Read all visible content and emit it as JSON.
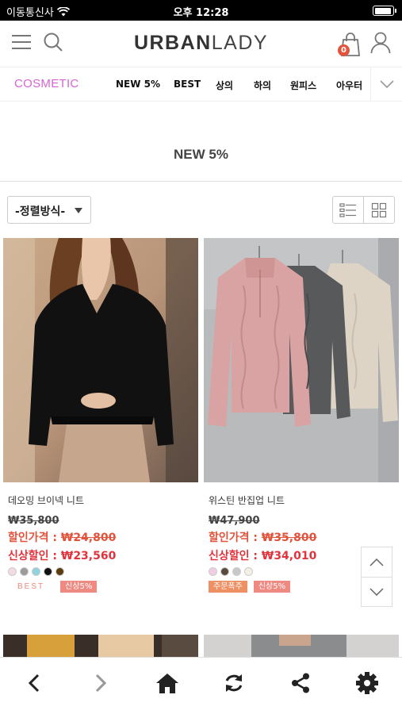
{
  "status_bar": {
    "carrier": "이동통신사",
    "time": "오후 12:28"
  },
  "header": {
    "logo_part1": "URBAN",
    "logo_part2": "LADY",
    "cart_count": "0"
  },
  "nav": {
    "cosmetic": "COSMETIC",
    "items": [
      "NEW 5%",
      "BEST",
      "상의",
      "하의",
      "원피스",
      "아우터"
    ]
  },
  "page_title": "NEW 5%",
  "sort": {
    "label": "-정렬방식-"
  },
  "products": [
    {
      "name": "데오밍 브이넥 니트",
      "original_price": "₩35,800",
      "discount_label": "할인가격 : ",
      "discount_price": "₩24,800",
      "new_label": "신상할인 : ",
      "new_price": "₩23,560",
      "swatches": [
        "#f2d9e4",
        "#9b9b9b",
        "#8fd3de",
        "#111111",
        "#5a3d10"
      ],
      "badges": [
        {
          "text": "BEST",
          "type": "best"
        },
        {
          "text": "신상5%",
          "type": "new"
        }
      ]
    },
    {
      "name": "위스틴 반집업 니트",
      "original_price": "₩47,900",
      "discount_label": "할인가격 : ",
      "discount_price": "₩35,800",
      "new_label": "신상할인 : ",
      "new_price": "₩34,010",
      "swatches": [
        "#f2cde2",
        "#5a4a3c",
        "#c8c8c8",
        "#f3efe4"
      ],
      "badges": [
        {
          "text": "주문폭주",
          "type": "order"
        },
        {
          "text": "신상5%",
          "type": "new"
        }
      ]
    }
  ],
  "colors": {
    "cosmetic": "#d764d1",
    "price_red": "#e2533c",
    "badge_new": "#ee8a82",
    "badge_order": "#ee9063"
  },
  "icons": {
    "toolbar": [
      "back-icon",
      "forward-icon",
      "home-icon",
      "refresh-icon",
      "share-icon",
      "settings-icon"
    ]
  }
}
